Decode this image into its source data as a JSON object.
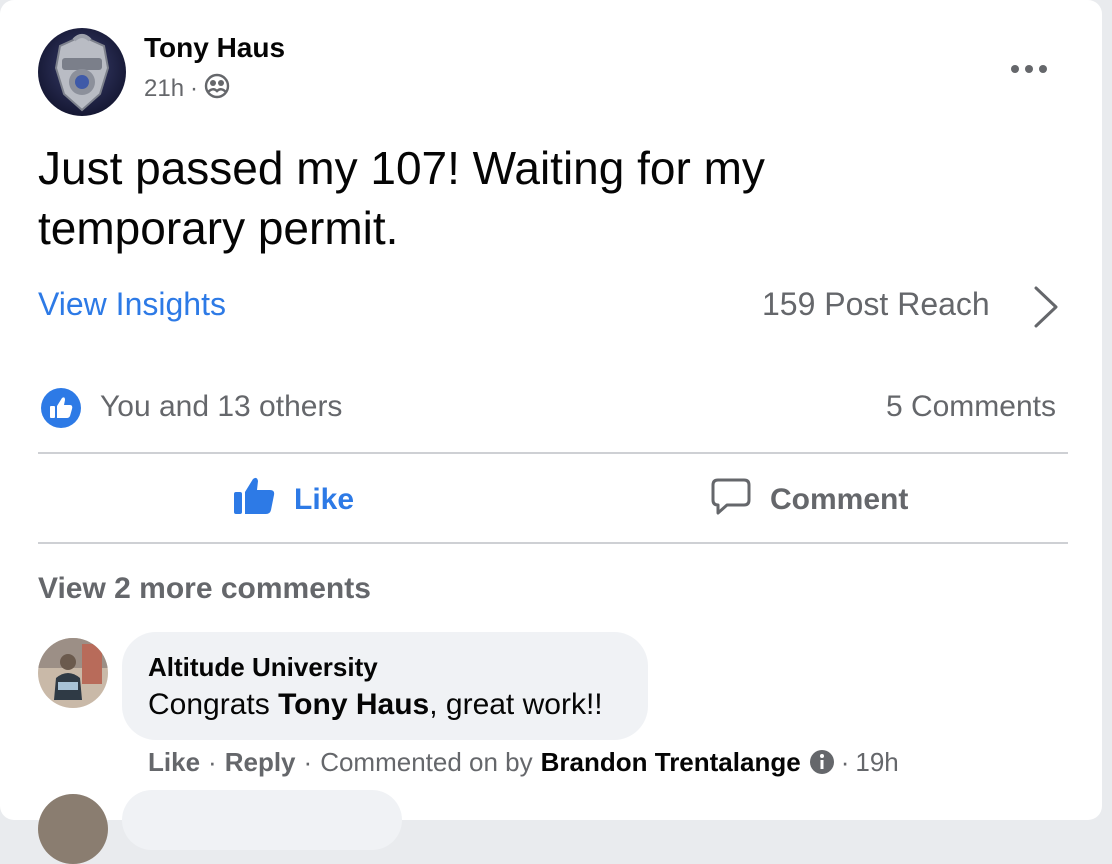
{
  "post": {
    "author": "Tony Haus",
    "time": "21h",
    "separator": "·",
    "audience_icon": "friends-icon",
    "text": "Just passed my 107! Waiting for my temporary permit.",
    "insights_link": "View Insights",
    "reach": "159 Post Reach",
    "reactions_summary": "You and 13 others",
    "comments_count": "5 Comments"
  },
  "actions": {
    "like": "Like",
    "comment": "Comment"
  },
  "comments": {
    "view_more": "View 2 more comments",
    "items": [
      {
        "author": "Altitude University",
        "text_prefix": "Congrats ",
        "mention": "Tony Haus",
        "text_suffix": ", great work!!",
        "like": "Like",
        "dot": "·",
        "reply": "Reply",
        "commented_on_by": "Commented on by",
        "commenter": "Brandon Trentalange",
        "time": "19h"
      }
    ]
  },
  "colors": {
    "accent": "#2d7ae6",
    "secondary_text": "#65676b",
    "primary_text": "#050505",
    "bubble": "#f0f2f5"
  }
}
